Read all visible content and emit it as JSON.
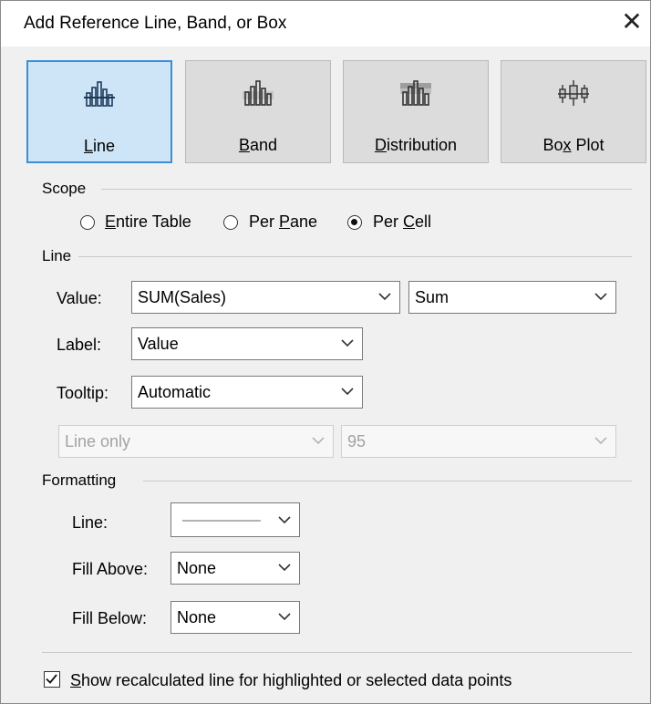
{
  "window": {
    "title": "Add Reference Line, Band, or Box",
    "close_glyph": "✕"
  },
  "tools": [
    {
      "label_pre": "",
      "label_ul": "L",
      "label_post": "ine",
      "selected": true,
      "icon": "bar-line-icon"
    },
    {
      "label_pre": "",
      "label_ul": "B",
      "label_post": "and",
      "selected": false,
      "icon": "bar-band-icon"
    },
    {
      "label_pre": "",
      "label_ul": "D",
      "label_post": "istribution",
      "selected": false,
      "icon": "bar-distribution-icon"
    },
    {
      "label_pre": "Bo",
      "label_ul": "x",
      "label_post": " Plot",
      "selected": false,
      "icon": "box-plot-icon"
    }
  ],
  "scope": {
    "heading": "Scope",
    "options": [
      {
        "pre": "",
        "ul": "E",
        "post": "ntire Table",
        "checked": false
      },
      {
        "pre": "Per ",
        "ul": "P",
        "post": "ane",
        "checked": false
      },
      {
        "pre": "Per ",
        "ul": "C",
        "post": "ell",
        "checked": true
      }
    ]
  },
  "line": {
    "heading": "Line",
    "value_label": "Value:",
    "value_field": "SUM(Sales)",
    "aggregation": "Sum",
    "label_label": "Label:",
    "label_value": "Value",
    "tooltip_label": "Tooltip:",
    "tooltip_value": "Automatic",
    "ci_type": "Line only",
    "ci_level": "95"
  },
  "formatting": {
    "heading": "Formatting",
    "line_label": "Line:",
    "fill_above_label": "Fill Above:",
    "fill_above_value": "None",
    "fill_below_label": "Fill Below:",
    "fill_below_value": "None"
  },
  "recalc": {
    "checked": true,
    "pre": "",
    "ul": "S",
    "post": "how recalculated line for highlighted or selected data points"
  },
  "colors": {
    "selected_fill": "#cde5f7",
    "selected_border": "#3c8ed9",
    "dialog_bg": "#f0f0f0"
  }
}
